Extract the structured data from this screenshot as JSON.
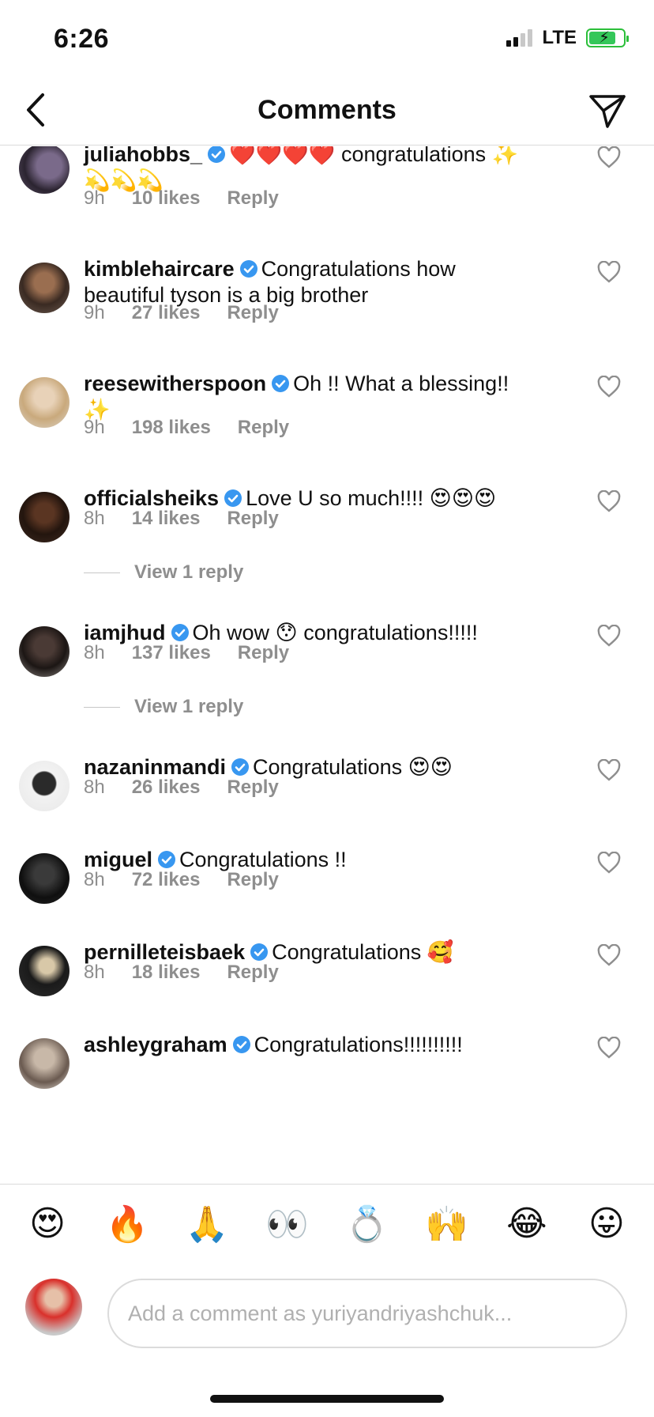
{
  "status_bar": {
    "time": "6:26",
    "network": "LTE"
  },
  "header": {
    "title": "Comments"
  },
  "comments": [
    {
      "username": "juliahobbs_",
      "text_line1": "❤️❤️❤️❤️ congratulations ✨",
      "text_line2": "💫💫💫",
      "time": "9h",
      "likes": "10 likes",
      "reply": "Reply"
    },
    {
      "username": "kimblehaircare",
      "text_line1": "Congratulations how",
      "text_line2": "beautiful tyson is a big brother",
      "time": "9h",
      "likes": "27 likes",
      "reply": "Reply"
    },
    {
      "username": "reesewitherspoon",
      "text_line1": "Oh !! What a blessing!!",
      "text_line2": "✨",
      "time": "9h",
      "likes": "198 likes",
      "reply": "Reply"
    },
    {
      "username": "officialsheiks",
      "text_line1": "Love U so much!!!! 😍😍😍",
      "time": "8h",
      "likes": "14 likes",
      "reply": "Reply",
      "view_replies": "View 1 reply"
    },
    {
      "username": "iamjhud",
      "text_line1": "Oh wow 😯 congratulations!!!!!",
      "time": "8h",
      "likes": "137 likes",
      "reply": "Reply",
      "view_replies": "View 1 reply"
    },
    {
      "username": "nazaninmandi",
      "text_line1": "Congratulations 😍😍",
      "time": "8h",
      "likes": "26 likes",
      "reply": "Reply"
    },
    {
      "username": "miguel",
      "text_line1": "Congratulations !!",
      "time": "8h",
      "likes": "72 likes",
      "reply": "Reply"
    },
    {
      "username": "pernilleteisbaek",
      "text_line1": "Congratulations 🥰",
      "time": "8h",
      "likes": "18 likes",
      "reply": "Reply"
    },
    {
      "username": "ashleygraham",
      "text_line1": "Congratulations!!!!!!!!!!"
    }
  ],
  "emoji_bar": [
    "😍",
    "🔥",
    "🙏",
    "👀",
    "💍",
    "🙌",
    "😂",
    "😛"
  ],
  "composer": {
    "placeholder": "Add a comment as yuriyandriyashchuk..."
  },
  "colors": {
    "verified": "#3897f0",
    "muted": "#8e8e8e",
    "battery": "#34c759"
  }
}
